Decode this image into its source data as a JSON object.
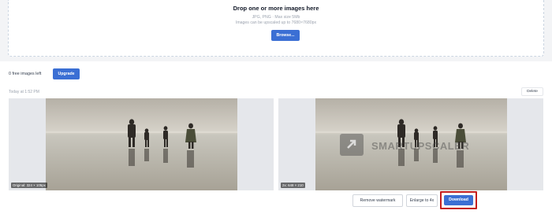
{
  "upload": {
    "title": "Drop one or more images here",
    "formats": "JPG, PNG · Max size 5Mb",
    "limit": "Images can be upscaled up to 7680×7680px",
    "browse_label": "Browse..."
  },
  "account": {
    "free_left": "0 free images left",
    "upgrade_label": "Upgrade"
  },
  "job": {
    "timestamp": "Today at 1:52 PM",
    "delete_label": "Delete",
    "original_badge": "Original: 324 × 105px",
    "result_badge": "2x: 648 × 210",
    "watermark_text": "SMARTUPSCALER",
    "actions": {
      "remove_watermark": "Remove watermark",
      "enlarge": "Enlarge to 4x",
      "download": "Download"
    }
  },
  "colors": {
    "primary": "#3b6fd4",
    "highlight": "#c41e1e"
  },
  "icons": {
    "watermark_logo": "expand-arrow-icon"
  }
}
